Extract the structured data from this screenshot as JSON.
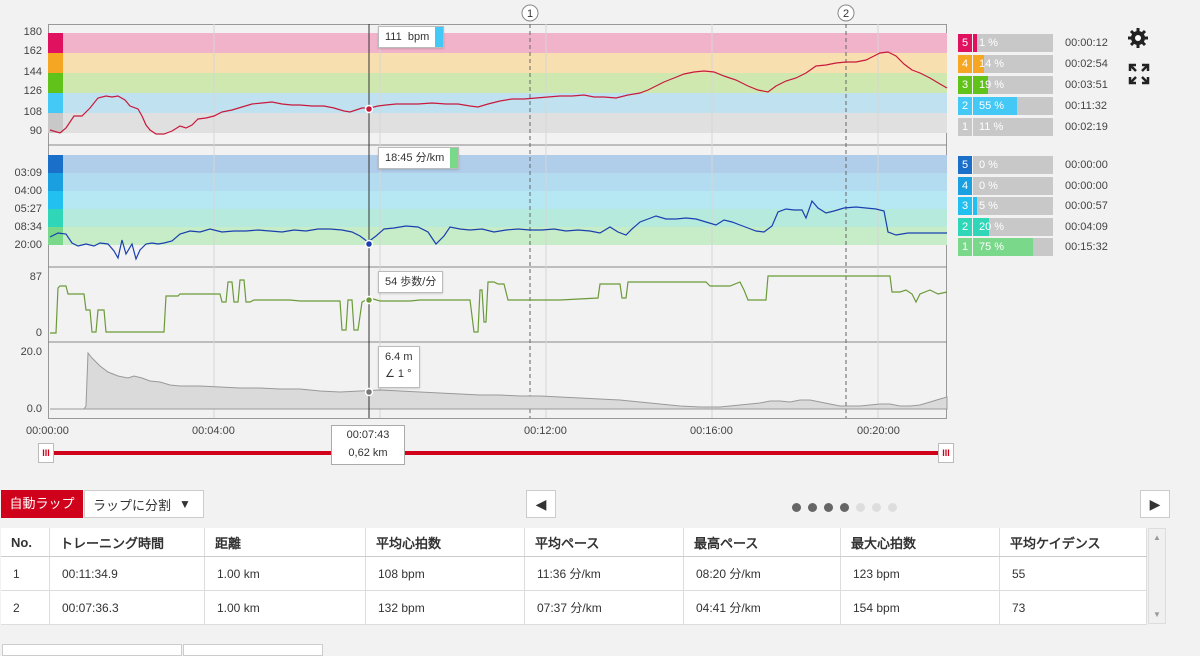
{
  "colors": {
    "hr_line": "#c8193c",
    "pace_line": "#1a3fb0",
    "cadence_line": "#6c9a3a",
    "accent_red": "#d0021b",
    "zone5_hr": "#e0115f",
    "zone4_hr": "#f5a623",
    "zone3_hr": "#61c31a",
    "zone2_hr": "#44c8f5",
    "zone1_hr": "#c8c8c8",
    "zone5_pace": "#1a6fc8",
    "zone4_pace": "#1a9fe0",
    "zone3_pace": "#22c0f0",
    "zone2_pace": "#2fd6b8",
    "zone1_pace": "#7ad88a"
  },
  "hr_chart": {
    "y_ticks": [
      "180",
      "162",
      "144",
      "126",
      "108",
      "90"
    ],
    "tooltip": "111  bpm",
    "marker_value": 111
  },
  "pace_chart": {
    "y_ticks": [
      "03:09",
      "04:00",
      "05:27",
      "08:34",
      "20:00"
    ],
    "tooltip": "18:45 分/km"
  },
  "cadence_chart": {
    "y_ticks": [
      "87",
      "0"
    ],
    "tooltip": "54 歩数/分",
    "marker_value": 54
  },
  "altitude_chart": {
    "y_ticks": [
      "20.0",
      "0.0"
    ],
    "tooltip_alt": "6.4 m",
    "tooltip_grade": "1 °"
  },
  "x_axis": {
    "ticks": [
      "00:00:00",
      "00:04:00",
      "00:08:00",
      "00:12:00",
      "00:16:00",
      "00:20:00"
    ],
    "cursor_time": "00:07:43",
    "cursor_dist": "0,62 km"
  },
  "lap_markers": [
    "1",
    "2"
  ],
  "hr_zones": [
    {
      "zone": "5",
      "pct": "1 %",
      "fill": 0.01,
      "time": "00:00:12"
    },
    {
      "zone": "4",
      "pct": "14 %",
      "fill": 0.14,
      "time": "00:02:54"
    },
    {
      "zone": "3",
      "pct": "19 %",
      "fill": 0.19,
      "time": "00:03:51"
    },
    {
      "zone": "2",
      "pct": "55 %",
      "fill": 0.55,
      "time": "00:11:32"
    },
    {
      "zone": "1",
      "pct": "11 %",
      "fill": 0.11,
      "time": "00:02:19"
    }
  ],
  "pace_zones": [
    {
      "zone": "5",
      "pct": "0 %",
      "fill": 0.0,
      "time": "00:00:00"
    },
    {
      "zone": "4",
      "pct": "0 %",
      "fill": 0.0,
      "time": "00:00:00"
    },
    {
      "zone": "3",
      "pct": "5 %",
      "fill": 0.05,
      "time": "00:00:57"
    },
    {
      "zone": "2",
      "pct": "20 %",
      "fill": 0.2,
      "time": "00:04:09"
    },
    {
      "zone": "1",
      "pct": "75 %",
      "fill": 0.75,
      "time": "00:15:32"
    }
  ],
  "controls": {
    "auto_lap": "自動ラップ",
    "split_lap": "ラップに分割",
    "pager_dots": 7,
    "pager_active": 4
  },
  "lap_table": {
    "headers": [
      "No.",
      "トレーニング時間",
      "距離",
      "平均心拍数",
      "平均ペース",
      "最高ペース",
      "最大心拍数",
      "平均ケイデンス"
    ],
    "rows": [
      [
        "1",
        "00:11:34.9",
        "1.00 km",
        "108 bpm",
        "11:36 分/km",
        "08:20 分/km",
        "123 bpm",
        "55"
      ],
      [
        "2",
        "00:07:36.3",
        "1.00 km",
        "132 bpm",
        "07:37 分/km",
        "04:41 分/km",
        "154 bpm",
        "73"
      ]
    ]
  }
}
